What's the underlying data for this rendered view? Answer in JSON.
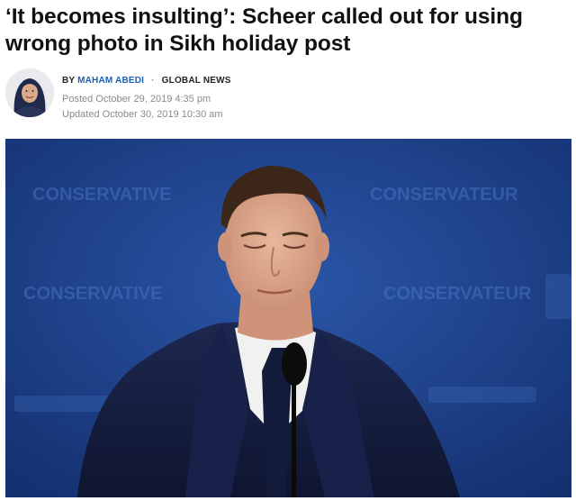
{
  "article": {
    "headline": "‘It becomes insulting’: Scheer called out for using wrong photo in Sikh holiday post",
    "byline": {
      "prefix": "BY",
      "author": "MAHAM ABEDI",
      "separator": "·",
      "outlet": "GLOBAL NEWS"
    },
    "posted": "Posted October 29, 2019 4:35 pm",
    "updated": "Updated October 30, 2019 10:30 am",
    "backdrop_text": [
      "CONSERVATIVE",
      "CONSERVATEUR",
      "CONSERVATIVE",
      "CONSERVATEUR"
    ]
  },
  "colors": {
    "author_link": "#1d5fb8",
    "backdrop_blue": "#1c3f86",
    "suit_navy": "#151d3a"
  }
}
